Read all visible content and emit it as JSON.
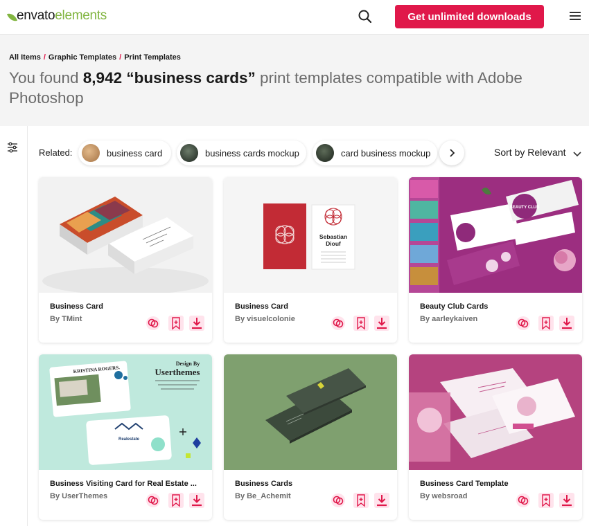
{
  "header": {
    "logo_part1": "envato",
    "logo_part2": "elements",
    "cta_label": "Get unlimited downloads",
    "search_icon": "search-icon",
    "menu_icon": "hamburger-icon"
  },
  "breadcrumb": [
    "All Items",
    "Graphic Templates",
    "Print Templates"
  ],
  "results": {
    "prefix": "You found",
    "count": "8,942",
    "query": "“business cards”",
    "suffix": "print templates compatible with Adobe Photoshop"
  },
  "related": {
    "label": "Related:",
    "chips": [
      "business card",
      "business cards mockup",
      "card business mockup"
    ]
  },
  "sort": {
    "label": "Sort by Relevant"
  },
  "cards": [
    {
      "title": "Business Card",
      "author": "By TMint"
    },
    {
      "title": "Business Card",
      "author": "By visuelcolonie"
    },
    {
      "title": "Beauty Club Cards",
      "author": "By aarleykaiven"
    },
    {
      "title": "Business Visiting Card for Real Estate ...",
      "author": "By UserThemes"
    },
    {
      "title": "Business Cards",
      "author": "By Be_Achemit"
    },
    {
      "title": "Business Card Template",
      "author": "By websroad"
    }
  ],
  "card_art": {
    "sebastian_name_1": "Sebastian",
    "sebastian_name_2": "Diouf",
    "beauty_text": "BEAUTY CLUB",
    "design_by": "Design By",
    "userthemes": "Userthemes",
    "kristina": "KRISTINA ROGERS.",
    "realestate": "Realestate"
  },
  "colors": {
    "accent": "#e0184a",
    "brand_green": "#82b541",
    "action_pink": "#ffe3ec"
  }
}
